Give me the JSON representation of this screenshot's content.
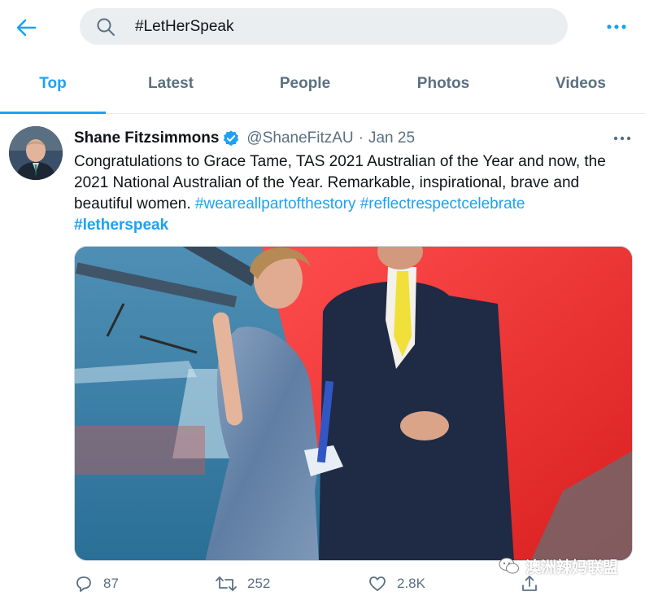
{
  "search": {
    "query": "#LetHerSpeak"
  },
  "tabs": [
    {
      "label": "Top",
      "active": true
    },
    {
      "label": "Latest",
      "active": false
    },
    {
      "label": "People",
      "active": false
    },
    {
      "label": "Photos",
      "active": false
    },
    {
      "label": "Videos",
      "active": false
    }
  ],
  "tweet": {
    "author_name": "Shane Fitzsimmons",
    "verified": true,
    "handle": "@ShaneFitzAU",
    "separator": "·",
    "date": "Jan 25",
    "text_main": "Congratulations to Grace Tame, TAS 2021 Australian of the Year and now, the 2021 National Australian of the Year. Remarkable, inspirational, brave and beautiful women. ",
    "hashtags": [
      "#weareallpartofthestory",
      "#reflectrespectcelebrate",
      "#letherspeak"
    ],
    "replies": "87",
    "retweets": "252",
    "likes": "2.8K"
  },
  "watermark": "澳洲辣妈联盟",
  "colors": {
    "accent": "#1da1f2",
    "secondary_text": "#5b7083",
    "divider": "#e6ecf0"
  }
}
